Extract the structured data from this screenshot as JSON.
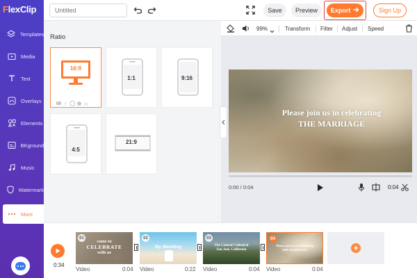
{
  "app": {
    "logo_prefix": "F",
    "logo_rest": "lexClip",
    "title_placeholder": "Untitled"
  },
  "sidebar": {
    "items": [
      {
        "label": "Templates",
        "icon": "layers-icon"
      },
      {
        "label": "Media",
        "icon": "media-folder-icon"
      },
      {
        "label": "Text",
        "icon": "text-icon"
      },
      {
        "label": "Overlays",
        "icon": "overlays-icon"
      },
      {
        "label": "Elements",
        "icon": "elements-icon"
      },
      {
        "label": "BKground",
        "icon": "background-icon"
      },
      {
        "label": "Music",
        "icon": "music-note-icon"
      },
      {
        "label": "Watermark",
        "icon": "watermark-icon"
      },
      {
        "label": "More",
        "icon": "more-dots-icon"
      }
    ],
    "active": "More"
  },
  "topbar": {
    "save_label": "Save",
    "preview_label": "Preview",
    "export_label": "Export",
    "signup_label": "Sign Up"
  },
  "ratio_panel": {
    "title": "Ratio",
    "options": [
      {
        "label": "16:9",
        "selected": true
      },
      {
        "label": "1:1",
        "selected": false
      },
      {
        "label": "9:16",
        "selected": false
      },
      {
        "label": "4:5",
        "selected": false
      },
      {
        "label": "21:9",
        "selected": false
      }
    ]
  },
  "edit_bar": {
    "zoom": "99%",
    "transform_label": "Transform",
    "filter_label": "Filter",
    "adjust_label": "Adjust",
    "speed_label": "Speed"
  },
  "preview": {
    "caption_line1": "Please join us in celebrating",
    "caption_line2": "THE MARRIAGE",
    "time_current": "0:00 / 0:04",
    "duration": "0:04"
  },
  "timeline": {
    "total_time": "0:34",
    "clips": [
      {
        "num": "01",
        "kind": "Video",
        "duration": "0:04",
        "title_lines": [
          "come to",
          "CELEBRATE",
          "with us"
        ]
      },
      {
        "num": "02",
        "kind": "Video",
        "duration": "0:22",
        "title_lines": [
          "My Wedding"
        ]
      },
      {
        "num": "03",
        "kind": "Video",
        "duration": "0:04",
        "title_lines": [
          "The Central Cathedral",
          "San José, California"
        ]
      },
      {
        "num": "04",
        "kind": "Video",
        "duration": "0:04",
        "title_lines": [
          "Please join us in celebrating",
          "THE MARRIAGE"
        ]
      }
    ]
  },
  "colors": {
    "brand_purple": "#4b3fc7",
    "accent_orange": "#ff7a2f",
    "highlight_red": "#e04343"
  }
}
